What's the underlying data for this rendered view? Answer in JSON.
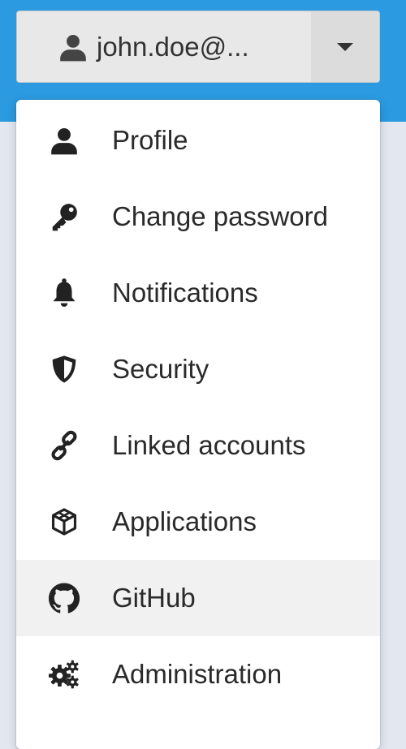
{
  "header": {
    "user_label": "john.doe@..."
  },
  "menu": {
    "items": [
      {
        "label": "Profile",
        "icon": "person-icon"
      },
      {
        "label": "Change password",
        "icon": "key-icon"
      },
      {
        "label": "Notifications",
        "icon": "bell-icon"
      },
      {
        "label": "Security",
        "icon": "shield-icon"
      },
      {
        "label": "Linked accounts",
        "icon": "link-icon"
      },
      {
        "label": "Applications",
        "icon": "cube-icon"
      },
      {
        "label": "GitHub",
        "icon": "github-icon",
        "highlighted": true
      },
      {
        "label": "Administration",
        "icon": "gears-icon"
      }
    ]
  },
  "colors": {
    "header_bar": "#2b9ae0",
    "page_background": "#e3e8f0",
    "highlight": "#f1f1f1"
  }
}
